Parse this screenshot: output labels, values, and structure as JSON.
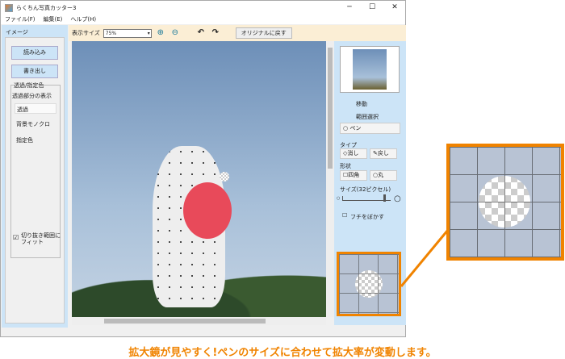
{
  "window": {
    "title": "らくちん写真カッター3",
    "minimize": "─",
    "maximize": "☐",
    "close": "✕"
  },
  "menu": [
    "ファイル(F)",
    "編集(E)",
    "ヘルプ(H)"
  ],
  "left": {
    "section": "イメージ",
    "load": "読み込み",
    "save": "書き出し",
    "group_title": "透過/指定色",
    "display_label": "透過部分の表示",
    "options": [
      "透過",
      "背景モノクロ",
      "指定色"
    ],
    "fit_label": "切り抜き範囲に\nフィット",
    "fit_checked": true
  },
  "toolbar": {
    "size_label": "表示サイズ",
    "size_value": "75%",
    "reset": "オリジナルに戻す"
  },
  "right": {
    "move": "移動",
    "range": "範囲選択",
    "pen": "ペン",
    "type_label": "タイプ",
    "erase": "消し",
    "restore": "戻し",
    "shape_label": "形状",
    "square": "四角",
    "circle": "丸",
    "size_label": "サイズ(32ピクセル)",
    "size_fraction": 0.85,
    "blur": "フチをぼかす"
  },
  "caption": "拡大鏡が見やすく!ペンのサイズに合わせて拡大率が変動します。",
  "colors": {
    "accent": "#f08300",
    "panel": "#cce4f7"
  }
}
